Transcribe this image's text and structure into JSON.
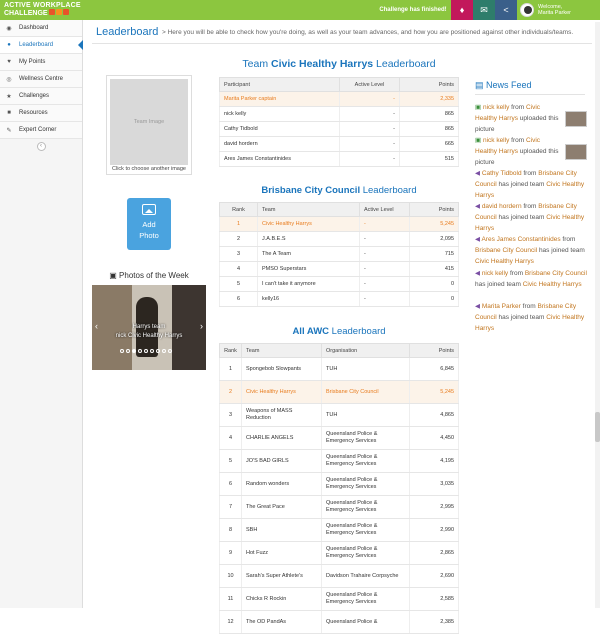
{
  "brand": {
    "line1": "ACTIVE WORKPLACE",
    "line2": "CHALLENGE"
  },
  "topbar": {
    "status": "Challenge has finished!",
    "welcome": "Welcome,",
    "user_name": "Marita Parker",
    "bell_icon": "bell-icon",
    "mail_icon": "envelope-icon",
    "share_icon": "share-icon"
  },
  "sidebar": {
    "items": [
      {
        "label": "Dashboard",
        "icon": "dashboard-icon"
      },
      {
        "label": "Leaderboard",
        "icon": "users-icon"
      },
      {
        "label": "My Points",
        "icon": "heart-icon"
      },
      {
        "label": "Wellness Centre",
        "icon": "globe-icon"
      },
      {
        "label": "Challenges",
        "icon": "trophy-icon"
      },
      {
        "label": "Resources",
        "icon": "folder-icon"
      },
      {
        "label": "Expert Corner",
        "icon": "pencil-icon"
      }
    ]
  },
  "header": {
    "title": "Leaderboard",
    "subtitle": "> Here you will be able to check how you're doing, as well as your team advances, and how you are positioned against other individuals/teams."
  },
  "team_image": {
    "placeholder": "Team Image",
    "caption": "Click to choose another image"
  },
  "add_photo": {
    "line1": "Add",
    "line2": "Photo"
  },
  "photos_of_week": {
    "title": "Photos of the Week",
    "caption_line1": "Harrys team",
    "caption_line2": "nick  Civic Healthy Harrys"
  },
  "team_board": {
    "title_bold": "Civic Healthy Harrys",
    "title_prefix": "Team ",
    "title_suffix": " Leaderboard",
    "columns": [
      "Participant",
      "Active Level",
      "Points"
    ],
    "rows": [
      {
        "name": "Marita Parker  captain",
        "level": "-",
        "points": "2,335",
        "highlight": true
      },
      {
        "name": "nick kelly",
        "level": "-",
        "points": "865"
      },
      {
        "name": "Cathy Tidbold",
        "level": "-",
        "points": "865"
      },
      {
        "name": "david hordern",
        "level": "-",
        "points": "665"
      },
      {
        "name": "Ares James Constantinides",
        "level": "-",
        "points": "515"
      }
    ]
  },
  "org_board": {
    "title_bold": "Brisbane City Council",
    "title_suffix": " Leaderboard",
    "columns": [
      "Rank",
      "Team",
      "Active Level",
      "Points"
    ],
    "rows": [
      {
        "rank": "1",
        "team": "Civic Healthy Harrys",
        "level": "-",
        "points": "5,245",
        "highlight": true
      },
      {
        "rank": "2",
        "team": "J.A.B.E.S",
        "level": "-",
        "points": "2,095"
      },
      {
        "rank": "3",
        "team": "The A Team",
        "level": "-",
        "points": "715"
      },
      {
        "rank": "4",
        "team": "PMSO Superstars",
        "level": "-",
        "points": "415"
      },
      {
        "rank": "5",
        "team": "I can't take it anymore",
        "level": "-",
        "points": "0"
      },
      {
        "rank": "6",
        "team": "kelly16",
        "level": "-",
        "points": "0"
      }
    ]
  },
  "awc_board": {
    "title_bold": "All AWC",
    "title_suffix": " Leaderboard",
    "columns": [
      "Rank",
      "Team",
      "Organisation",
      "Points"
    ],
    "rows": [
      {
        "rank": "1",
        "team": "Spongebob Slowpants",
        "org": "TUH",
        "points": "6,845"
      },
      {
        "rank": "2",
        "team": "Civic Healthy Harrys",
        "org": "Brisbane City Council",
        "points": "5,245",
        "highlight": true
      },
      {
        "rank": "3",
        "team": "Weapons of MASS Reduction",
        "org": "TUH",
        "points": "4,865"
      },
      {
        "rank": "4",
        "team": "CHARLIE ANGELS",
        "org": "Queensland Police & Emergency Services",
        "points": "4,450"
      },
      {
        "rank": "5",
        "team": "JO'S BAD GIRLS",
        "org": "Queensland Police & Emergency Services",
        "points": "4,195"
      },
      {
        "rank": "6",
        "team": "Random wonders",
        "org": "Queensland Police & Emergency Services",
        "points": "3,035"
      },
      {
        "rank": "7",
        "team": "The Great Pace",
        "org": "Queensland Police & Emergency Services",
        "points": "2,995"
      },
      {
        "rank": "8",
        "team": "SBH",
        "org": "Queensland Police & Emergency Services",
        "points": "2,990"
      },
      {
        "rank": "9",
        "team": "Hot Fuzz",
        "org": "Queensland Police & Emergency Services",
        "points": "2,865"
      },
      {
        "rank": "10",
        "team": "Sarah's Super Athlete's",
        "org": "Davidson Trahaire Corpsyche",
        "points": "2,690"
      },
      {
        "rank": "11",
        "team": "Chicks R Rockin",
        "org": "Queensland Police & Emergency Services",
        "points": "2,585"
      },
      {
        "rank": "12",
        "team": "The OD PandAs",
        "org": "Queensland Police &",
        "points": "2,385"
      }
    ]
  },
  "news_feed": {
    "title": "News Feed",
    "items": [
      {
        "icon": "picture-icon",
        "name": "nick kelly",
        "mid": " from ",
        "org": "Civic Healthy Harrys",
        "tail": " uploaded this picture",
        "thumb": true
      },
      {
        "icon": "picture-icon",
        "name": "nick kelly",
        "mid": " from ",
        "org": "Civic Healthy Harrys",
        "tail": " uploaded this picture",
        "thumb": true
      },
      {
        "icon": "megaphone-icon",
        "name": "Cathy Tidbold",
        "mid": " from ",
        "org": "Brisbane City Council",
        "tail": " has joined team ",
        "team": "Civic Healthy Harrys"
      },
      {
        "icon": "megaphone-icon",
        "name": "david hordern",
        "mid": " from ",
        "org": "Brisbane City Council",
        "tail": " has joined team ",
        "team": "Civic Healthy Harrys"
      },
      {
        "icon": "megaphone-icon",
        "name": "Ares James Constantinides",
        "mid": " from ",
        "org": "Brisbane City Council",
        "tail": " has joined team ",
        "team": "Civic Healthy Harrys"
      },
      {
        "icon": "megaphone-icon",
        "name": "nick kelly",
        "mid": " from ",
        "org": "Brisbane City Council",
        "tail": " has joined team ",
        "team": "Civic Healthy Harrys"
      },
      {
        "icon": "megaphone-icon",
        "name": "Marita Parker",
        "mid": " from ",
        "org": "Brisbane City Council",
        "tail": " has joined team ",
        "team": "Civic Healthy Harrys"
      }
    ]
  }
}
